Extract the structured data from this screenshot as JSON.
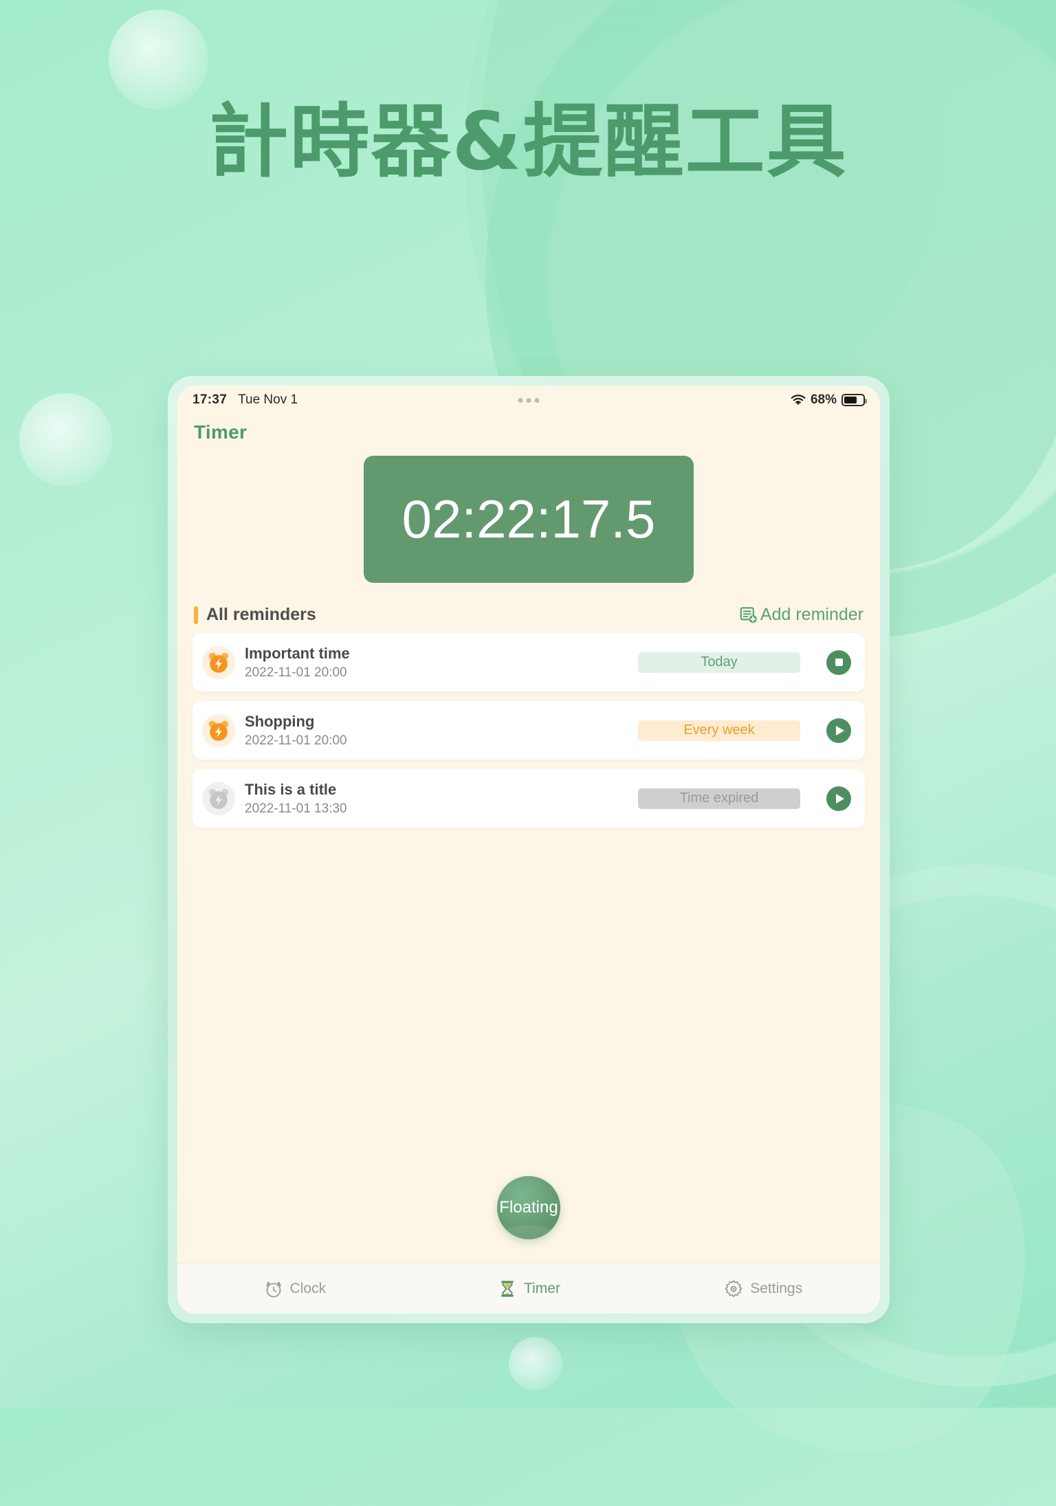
{
  "poster": {
    "headline": "計時器&提醒工具",
    "accent_green": "#4d9b6c",
    "bg_mint": "#a4ecc9"
  },
  "statusbar": {
    "time": "17:37",
    "date": "Tue Nov 1",
    "battery_percent": "68%",
    "wifi_icon": "wifi-icon",
    "battery_icon": "battery-icon",
    "dots_icon": "more-dots-icon"
  },
  "app": {
    "title": "Timer",
    "timer_value": "02:22:17.5",
    "timer_bg": "#63996f"
  },
  "reminders_section": {
    "heading": "All reminders",
    "accent_bar_color": "#f5b33f",
    "add_label": "Add reminder",
    "add_icon": "add-document-icon",
    "items": [
      {
        "name": "Important time",
        "datetime": "2022-11-01 20:00",
        "badge": "Today",
        "badge_style": "today",
        "badge_bg": "#e3f0e6",
        "badge_fg": "#5fa075",
        "icon": "alarm-clock-icon",
        "icon_state": "active",
        "action": "stop",
        "action_icon": "stop-icon"
      },
      {
        "name": "Shopping",
        "datetime": "2022-11-01 20:00",
        "badge": "Every week",
        "badge_style": "weekly",
        "badge_bg": "#fdeccf",
        "badge_fg": "#eb9f36",
        "icon": "alarm-clock-icon",
        "icon_state": "active",
        "action": "play",
        "action_icon": "play-icon"
      },
      {
        "name": "This is a title",
        "datetime": "2022-11-01 13:30",
        "badge": "Time expired",
        "badge_style": "expired",
        "badge_bg": "#cfcfcf",
        "badge_fg": "#9a9a9a",
        "icon": "alarm-clock-icon",
        "icon_state": "disabled",
        "action": "play",
        "action_icon": "play-icon"
      }
    ]
  },
  "floating_button": {
    "label": "Floating"
  },
  "bottom_nav": {
    "items": [
      {
        "label": "Clock",
        "icon": "alarm-clock-icon",
        "active": false
      },
      {
        "label": "Timer",
        "icon": "hourglass-icon",
        "active": true
      },
      {
        "label": "Settings",
        "icon": "gear-icon",
        "active": false
      }
    ]
  }
}
